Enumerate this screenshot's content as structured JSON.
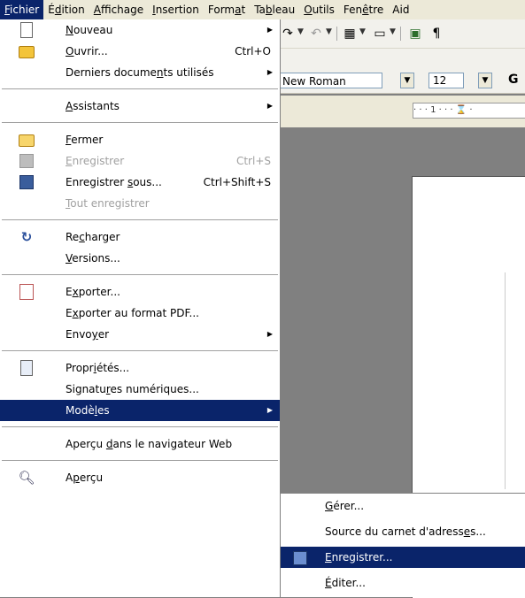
{
  "menubar": {
    "items": [
      {
        "label": "Fichier",
        "u": 0
      },
      {
        "label": "Édition",
        "u": 1
      },
      {
        "label": "Affichage",
        "u": 0
      },
      {
        "label": "Insertion",
        "u": 0
      },
      {
        "label": "Format",
        "u": 4
      },
      {
        "label": "Tableau",
        "u": 2
      },
      {
        "label": "Outils",
        "u": 0
      },
      {
        "label": "Fenêtre",
        "u": 3
      },
      {
        "label": "Aid",
        "u": -1
      }
    ]
  },
  "toolbar": {
    "font_name": "New Roman",
    "font_size": "12",
    "ruler_text": "· · · 1 · · · ⌛ ·"
  },
  "file_menu": {
    "items": [
      {
        "label": "Nouveau",
        "u": 0,
        "icon": "new-document-icon",
        "submenu": true
      },
      {
        "label": "Ouvrir...",
        "u": 0,
        "icon": "open-folder-icon",
        "shortcut": "Ctrl+O"
      },
      {
        "label": "Derniers documents utilisés",
        "u": 15,
        "submenu": true
      },
      {
        "sep": true
      },
      {
        "label": "Assistants",
        "u": 0,
        "submenu": true
      },
      {
        "sep": true
      },
      {
        "label": "Fermer",
        "u": 0,
        "icon": "close-document-icon"
      },
      {
        "label": "Enregistrer",
        "u": 0,
        "icon": "save-icon",
        "shortcut": "Ctrl+S",
        "disabled": true
      },
      {
        "label": "Enregistrer sous...",
        "u": 12,
        "icon": "save-as-icon",
        "shortcut": "Ctrl+Shift+S"
      },
      {
        "label": "Tout enregistrer",
        "u": 0,
        "disabled": true
      },
      {
        "sep": true
      },
      {
        "label": "Recharger",
        "u": 2,
        "icon": "reload-icon"
      },
      {
        "label": "Versions...",
        "u": 0
      },
      {
        "sep": true
      },
      {
        "label": "Exporter...",
        "u": 1,
        "icon": "export-icon"
      },
      {
        "label": "Exporter au format PDF...",
        "u": 1
      },
      {
        "label": "Envoyer",
        "u": 4,
        "submenu": true
      },
      {
        "sep": true
      },
      {
        "label": "Propriétés...",
        "u": 5,
        "icon": "properties-icon"
      },
      {
        "label": "Signatures numériques...",
        "u": 7
      },
      {
        "label": "Modèles",
        "u": 4,
        "submenu": true,
        "highlighted": true
      },
      {
        "sep": true
      },
      {
        "label": "Aperçu dans le navigateur Web",
        "u": 7
      },
      {
        "sep": true
      },
      {
        "label": "Aperçu",
        "u": 1,
        "icon": "preview-icon"
      }
    ]
  },
  "sub_menu": {
    "items": [
      {
        "label": "Gérer...",
        "u": 0
      },
      {
        "label": "Source du carnet d'adresses...",
        "u": 25
      },
      {
        "label": "Enregistrer...",
        "u": 0,
        "icon": "save-template-icon",
        "highlighted": true
      },
      {
        "label": "Éditer...",
        "u": 0
      }
    ]
  }
}
